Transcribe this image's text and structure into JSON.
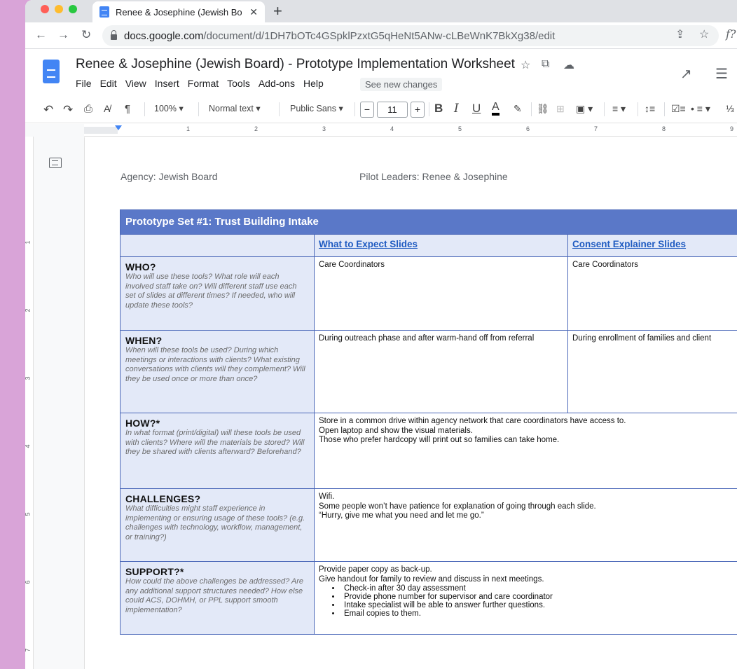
{
  "browser": {
    "tab_title": "Renee & Josephine (Jewish Bo",
    "tab_close": "✕",
    "new_tab": "+",
    "url_host": "docs.google.com",
    "url_path": "/document/d/1DH7bOTc4GSpklPzxtG5qHeNt5ANw-cLBeWnK7BkXg38/edit",
    "url_partial_right": "f?"
  },
  "docs": {
    "title": "Renee & Josephine (Jewish Board) - Prototype Implementation Worksheet",
    "menu": [
      "File",
      "Edit",
      "View",
      "Insert",
      "Format",
      "Tools",
      "Add-ons",
      "Help"
    ],
    "see_new_changes": "See new changes",
    "toolbar": {
      "zoom": "100%",
      "style": "Normal text",
      "font": "Public Sans",
      "font_size": "11",
      "minus": "−",
      "plus": "+"
    },
    "ruler_numbers": [
      "1",
      "2",
      "3",
      "4",
      "5",
      "6",
      "7",
      "8",
      "9"
    ],
    "vruler_numbers": [
      "1",
      "2",
      "3",
      "4",
      "5",
      "6",
      "7"
    ]
  },
  "document": {
    "agency": "Agency: Jewish Board",
    "pilot_leaders": "Pilot Leaders: Renee & Josephine",
    "table_title": "Prototype Set #1: Trust Building Intake",
    "columns": [
      "What to Expect Slides",
      "Consent Explainer Slides"
    ],
    "rows": [
      {
        "title": "WHO?",
        "desc": "Who will use these tools? What role will each involved staff take on? Will different staff use each set of slides at different times? If needed, who will update these tools?",
        "col1": "Care Coordinators",
        "col2": "Care Coordinators"
      },
      {
        "title": "WHEN?",
        "desc": "When will these tools be used? During which meetings or interactions with clients? What existing conversations with clients will they complement? Will they be used once or more than once?",
        "col1": "During outreach phase and after warm-hand off from referral",
        "col2": "During enrollment of families and client"
      },
      {
        "title": "HOW?*",
        "desc": "In what format (print/digital) will these tools be used with clients? Where will the materials be stored? Will they be shared with clients afterward? Beforehand?",
        "lines": [
          "Store in a common drive within agency network that care coordinators have access to.",
          "Open laptop and show the visual materials.",
          "Those who prefer hardcopy will print out so families can take home."
        ]
      },
      {
        "title": "CHALLENGES?",
        "desc": "What difficulties might staff experience in implementing or ensuring usage of these tools? (e.g. challenges with technology, workflow, management, or training?)",
        "lines": [
          "Wifi.",
          "Some people won’t have patience for explanation of going through each slide.",
          "“Hurry, give me what you need and let me go.”"
        ]
      },
      {
        "title": "SUPPORT?*",
        "desc": "How could the above challenges be addressed? Are any additional support structures needed? How else could ACS, DOHMH, or PPL support smooth implementation?",
        "lines": [
          "Provide paper copy as back-up.",
          "Give handout for family to review and discuss in next meetings."
        ],
        "bullets": [
          "Check-in after 30 day assessment",
          "Provide phone number for supervisor and care coordinator",
          "Intake specialist will be able to answer further questions.",
          "Email copies to them."
        ]
      }
    ]
  }
}
